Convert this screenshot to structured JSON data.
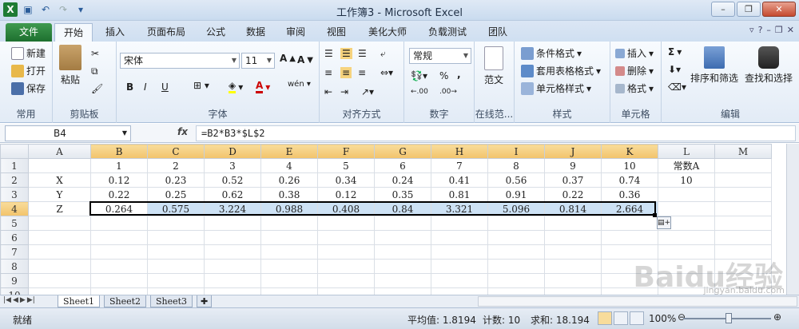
{
  "window": {
    "title": "工作簿3 - Microsoft Excel"
  },
  "ribbon_tabs": [
    "文件",
    "开始",
    "插入",
    "页面布局",
    "公式",
    "数据",
    "审阅",
    "视图",
    "美化大师",
    "负载测试",
    "团队"
  ],
  "clipboard": {
    "new": "新建",
    "open": "打开",
    "save": "保存",
    "paste": "粘贴",
    "group_common": "常用",
    "group_label": "剪贴板"
  },
  "font": {
    "name": "宋体",
    "size": "11",
    "group_label": "字体",
    "bold": "B",
    "italic": "I",
    "underline": "U"
  },
  "alignment": {
    "group_label": "对齐方式"
  },
  "number": {
    "format": "常规",
    "percent": "%",
    "comma": ",",
    "group_label": "数字"
  },
  "online": {
    "label": "范文",
    "group_label": "在线范..."
  },
  "styles": {
    "conditional": "条件格式",
    "table_format": "套用表格格式",
    "cell_style": "单元格样式",
    "group_label": "样式"
  },
  "cells": {
    "insert": "插入",
    "delete": "删除",
    "format": "格式",
    "group_label": "单元格"
  },
  "editing": {
    "sort_filter": "排序和筛选",
    "find_select": "查找和选择",
    "group_label": "编辑",
    "sigma": "Σ"
  },
  "formula_bar": {
    "name_box": "B4",
    "fx": "fx",
    "formula": "=B2*B3*$L$2"
  },
  "sheet": {
    "columns": [
      "A",
      "B",
      "C",
      "D",
      "E",
      "F",
      "G",
      "H",
      "I",
      "J",
      "K",
      "L",
      "M"
    ],
    "rows": [
      {
        "num": "1",
        "cells": [
          "",
          "1",
          "2",
          "3",
          "4",
          "5",
          "6",
          "7",
          "8",
          "9",
          "10",
          "常数A",
          ""
        ]
      },
      {
        "num": "2",
        "cells": [
          "X",
          "0.12",
          "0.23",
          "0.52",
          "0.26",
          "0.34",
          "0.24",
          "0.41",
          "0.56",
          "0.37",
          "0.74",
          "10",
          ""
        ]
      },
      {
        "num": "3",
        "cells": [
          "Y",
          "0.22",
          "0.25",
          "0.62",
          "0.38",
          "0.12",
          "0.35",
          "0.81",
          "0.91",
          "0.22",
          "0.36",
          "",
          ""
        ]
      },
      {
        "num": "4",
        "cells": [
          "Z",
          "0.264",
          "0.575",
          "3.224",
          "0.988",
          "0.408",
          "0.84",
          "3.321",
          "5.096",
          "0.814",
          "2.664",
          "",
          ""
        ]
      },
      {
        "num": "5",
        "cells": [
          "",
          "",
          "",
          "",
          "",
          "",
          "",
          "",
          "",
          "",
          "",
          "",
          ""
        ]
      },
      {
        "num": "6",
        "cells": [
          "",
          "",
          "",
          "",
          "",
          "",
          "",
          "",
          "",
          "",
          "",
          "",
          ""
        ]
      },
      {
        "num": "7",
        "cells": [
          "",
          "",
          "",
          "",
          "",
          "",
          "",
          "",
          "",
          "",
          "",
          "",
          ""
        ]
      },
      {
        "num": "8",
        "cells": [
          "",
          "",
          "",
          "",
          "",
          "",
          "",
          "",
          "",
          "",
          "",
          "",
          ""
        ]
      },
      {
        "num": "9",
        "cells": [
          "",
          "",
          "",
          "",
          "",
          "",
          "",
          "",
          "",
          "",
          "",
          "",
          ""
        ]
      },
      {
        "num": "10",
        "cells": [
          "",
          "",
          "",
          "",
          "",
          "",
          "",
          "",
          "",
          "",
          "",
          "",
          ""
        ]
      }
    ],
    "tabs": [
      "Sheet1",
      "Sheet2",
      "Sheet3"
    ],
    "active_tab": "Sheet1"
  },
  "status": {
    "ready": "就绪",
    "average": "平均值: 1.8194",
    "count": "计数: 10",
    "sum": "求和: 18.194",
    "zoom": "100%"
  },
  "watermark": {
    "main": "Baidu经验",
    "sub": "jingyan.baidu.com"
  }
}
